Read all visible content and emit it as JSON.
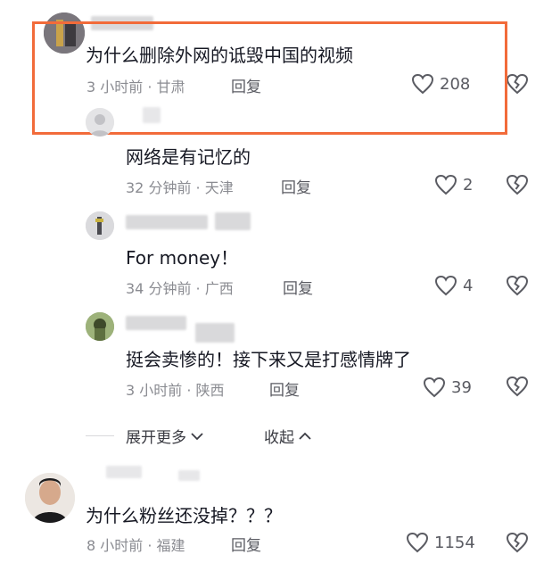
{
  "comments": [
    {
      "text": "为什么删除外网的诋毁中国的视频",
      "time": "3 小时前 · 甘肃",
      "reply_label": "回复",
      "likes": "208",
      "highlighted": true
    },
    {
      "text": "网络是有记忆的",
      "time": "32 分钟前 · 天津",
      "reply_label": "回复",
      "likes": "2"
    },
    {
      "text": "For money！",
      "time": "34 分钟前 · 广西",
      "reply_label": "回复",
      "likes": "4"
    },
    {
      "text": "挺会卖惨的！接下来又是打感情牌了",
      "time": "3 小时前 · 陕西",
      "reply_label": "回复",
      "likes": "39"
    },
    {
      "text": "为什么粉丝还没掉？？？",
      "time": "8 小时前 · 福建",
      "reply_label": "回复",
      "likes": "1154"
    }
  ],
  "thread_controls": {
    "expand_more": "展开更多",
    "collapse": "收起"
  },
  "colors": {
    "highlight_border": "#f26b3a",
    "primary_text": "#161823",
    "secondary_text": "#8a8b91"
  }
}
